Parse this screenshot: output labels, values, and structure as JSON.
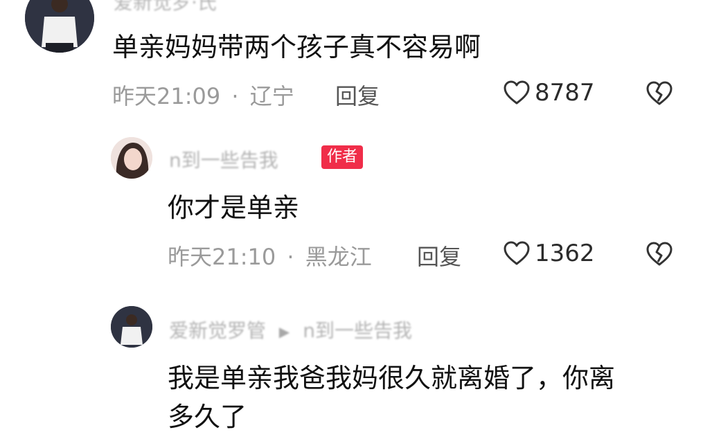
{
  "comments": [
    {
      "username": "爱新觉罗·氏",
      "body": "单亲妈妈带两个孩子真不容易啊",
      "time": "昨天21:09",
      "location": "辽宁",
      "separator": "·",
      "reply_label": "回复",
      "likes": "8787",
      "like_icon": "heart-outline-icon",
      "dislike_icon": "broken-heart-icon"
    },
    {
      "username": "n到一些告我",
      "badge": "作者",
      "body": "你才是单亲",
      "time": "昨天21:10",
      "location": "黑龙江",
      "separator": "·",
      "reply_label": "回复",
      "likes": "1362",
      "like_icon": "heart-outline-icon",
      "dislike_icon": "broken-heart-icon"
    },
    {
      "username": "爱新觉罗管",
      "reply_to": "n到一些告我",
      "body_line1": "我是单亲我爸我妈很久就离婚了，你离",
      "body_line2": "多久了"
    }
  ],
  "colors": {
    "badge_bg": "#f02d49",
    "meta_text": "#9a9a9a",
    "body_text": "#111111"
  }
}
